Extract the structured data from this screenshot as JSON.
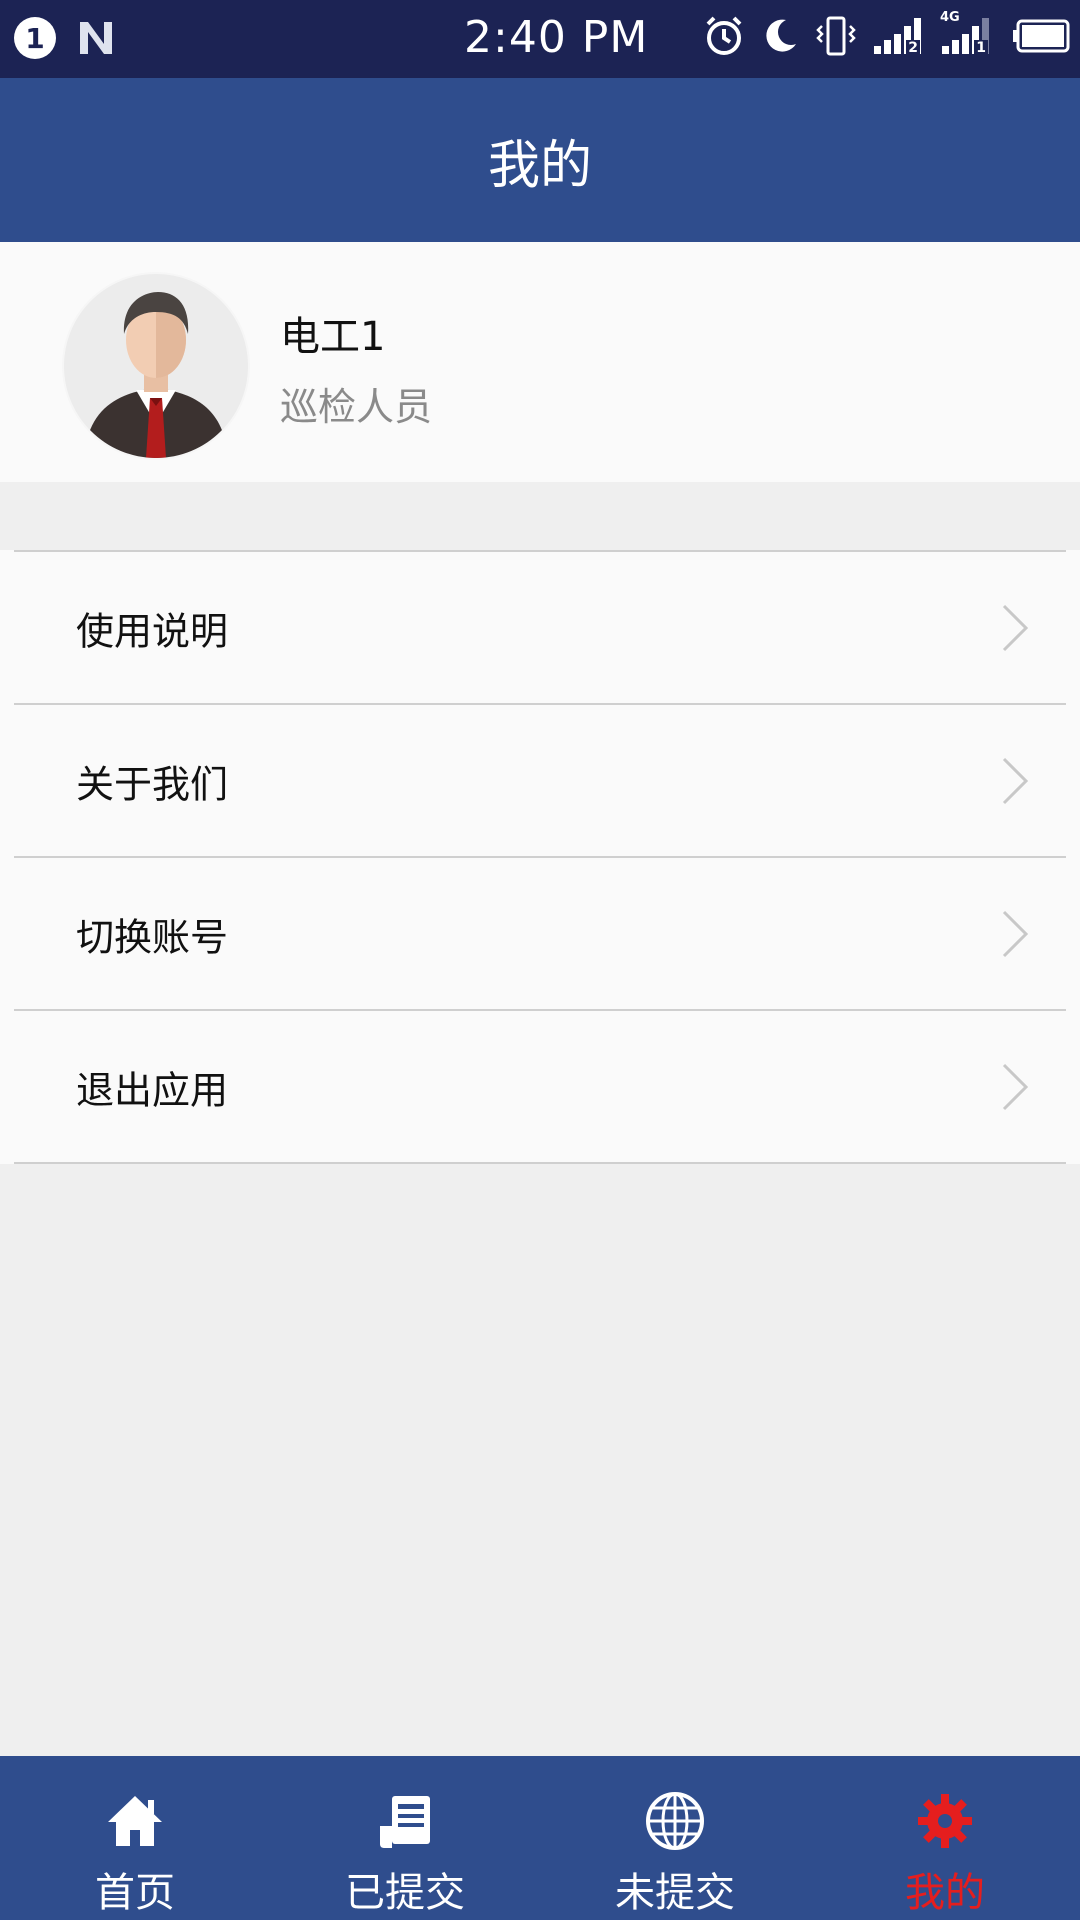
{
  "status_bar": {
    "notification_count": "1",
    "time": "2:40 PM",
    "signal_1_label": "2",
    "network_type": "4G",
    "signal_2_label": "1",
    "icons": [
      "alarm-icon",
      "moon-icon",
      "vibrate-icon",
      "signal-icon",
      "signal-4g-icon",
      "battery-icon"
    ]
  },
  "header": {
    "title": "我的"
  },
  "profile": {
    "name": "电工1",
    "role": "巡检人员",
    "avatar_icon": "avatar-icon"
  },
  "menu": {
    "items": [
      {
        "label": "使用说明",
        "icon": "chevron-right-icon"
      },
      {
        "label": "关于我们",
        "icon": "chevron-right-icon"
      },
      {
        "label": "切换账号",
        "icon": "chevron-right-icon"
      },
      {
        "label": "退出应用",
        "icon": "chevron-right-icon"
      }
    ]
  },
  "bottom_nav": {
    "items": [
      {
        "label": "首页",
        "icon": "home-icon",
        "active": false
      },
      {
        "label": "已提交",
        "icon": "document-icon",
        "active": false
      },
      {
        "label": "未提交",
        "icon": "globe-icon",
        "active": false
      },
      {
        "label": "我的",
        "icon": "gear-icon",
        "active": true
      }
    ],
    "active_color": "#e51e1e"
  },
  "colors": {
    "status_bar": "#1c2354",
    "header": "#2f4d8d",
    "background": "#efefef"
  }
}
